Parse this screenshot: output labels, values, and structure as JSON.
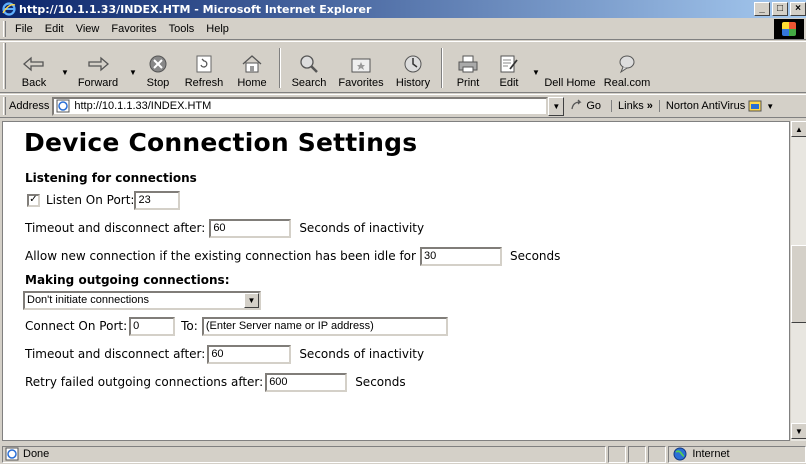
{
  "window": {
    "title": "http://10.1.1.33/INDEX.HTM - Microsoft Internet Explorer"
  },
  "menu": [
    "File",
    "Edit",
    "View",
    "Favorites",
    "Tools",
    "Help"
  ],
  "toolbar": {
    "back": "Back",
    "forward": "Forward",
    "stop": "Stop",
    "refresh": "Refresh",
    "home": "Home",
    "search": "Search",
    "favorites": "Favorites",
    "history": "History",
    "print": "Print",
    "edit": "Edit",
    "dell_home": "Dell Home",
    "realcom": "Real.com"
  },
  "address": {
    "label": "Address",
    "url": "http://10.1.1.33/INDEX.HTM",
    "go": "Go",
    "links": "Links",
    "links_chevron": "»",
    "norton": "Norton AntiVirus"
  },
  "page": {
    "title": "Device Connection Settings",
    "listening_heading": "Listening for connections",
    "listen_on_port_label": "Listen On Port:",
    "listen_on_port_value": "23",
    "listen_checked": "✓",
    "timeout_label": "Timeout and disconnect after:",
    "timeout_value": "60",
    "timeout_suffix": "Seconds of inactivity",
    "allow_label": "Allow new connection if the existing connection has been idle for",
    "allow_value": "30",
    "allow_suffix": "Seconds",
    "outgoing_heading": "Making outgoing connections:",
    "outgoing_select": "Don't initiate connections",
    "connect_port_label": "Connect On Port:",
    "connect_port_value": "0",
    "to_label": "To:",
    "to_value": "(Enter Server name or IP address)",
    "out_timeout_label": "Timeout and disconnect after:",
    "out_timeout_value": "60",
    "out_timeout_suffix": "Seconds of inactivity",
    "retry_label": "Retry failed outgoing connections after:",
    "retry_value": "600",
    "retry_suffix": "Seconds"
  },
  "status": {
    "text": "Done",
    "zone": "Internet"
  }
}
